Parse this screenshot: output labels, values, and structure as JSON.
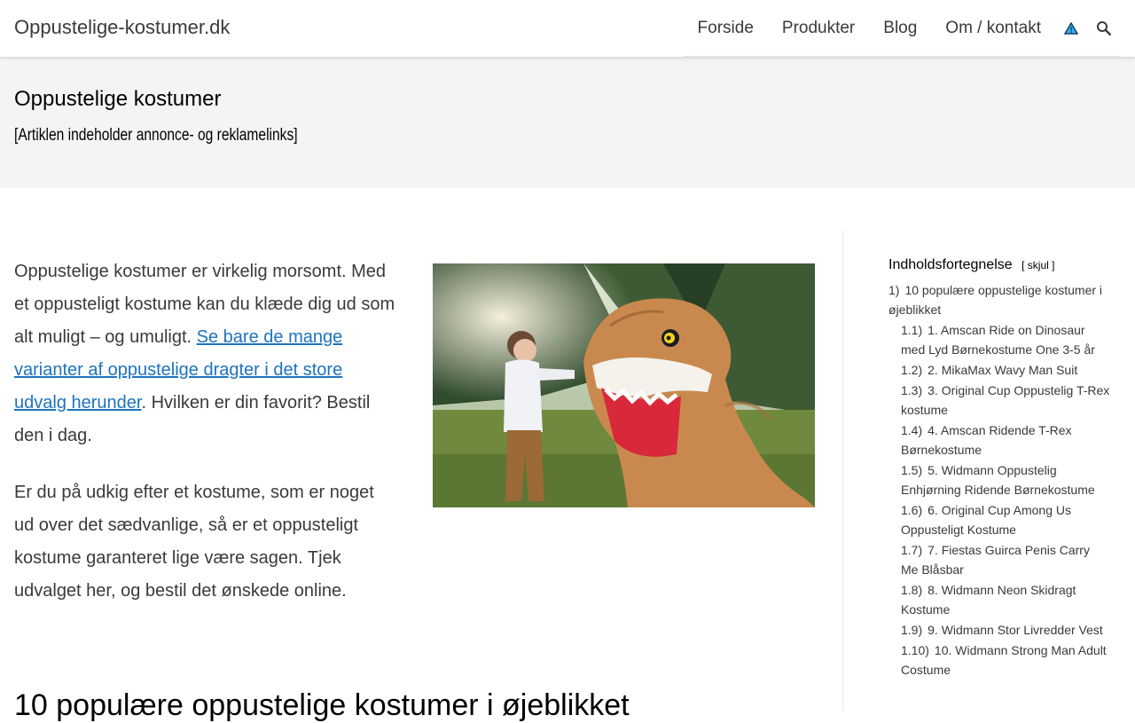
{
  "header": {
    "site_title": "Oppustelige-kostumer.dk",
    "nav": [
      "Forside",
      "Produkter",
      "Blog",
      "Om / kontakt"
    ],
    "icons": [
      "warning-triangle-icon",
      "search-icon"
    ]
  },
  "hero": {
    "title": "Oppustelige kostumer",
    "notice": "[Artiklen indeholder annonce- og reklamelinks]"
  },
  "content": {
    "p1_start": "Oppustelige kostumer er virkelig morsomt. Med et oppusteligt kostume kan du klæde dig ud som alt muligt – og umuligt. ",
    "p1_link": "Se bare de mange varianter af oppustelige dragter i det store udvalg herunder",
    "p1_end": ". Hvilken er din favorit? Bestil den i dag.",
    "p2": "Er du på udkig efter et kostume, som er noget ud over det sædvanlige, så er et oppusteligt kostume garanteret lige være sagen. Tjek udvalget her, og bestil det ønskede online.",
    "section_heading": "10 populære oppustelige kostumer i øjeblikket"
  },
  "toc": {
    "title": "Indholdsfortegnelse",
    "toggle": "[ skjul ]",
    "main": {
      "num": "1)",
      "label": "10 populære oppustelige kostumer i øjeblikket"
    },
    "items": [
      {
        "num": "1.1)",
        "label": "1. Amscan Ride on Dinosaur med Lyd Børnekostume One 3-5 år"
      },
      {
        "num": "1.2)",
        "label": "2. MikaMax Wavy Man Suit"
      },
      {
        "num": "1.3)",
        "label": "3. Original Cup Oppustelig T-Rex kostume"
      },
      {
        "num": "1.4)",
        "label": "4. Amscan Ridende T-Rex Børnekostume"
      },
      {
        "num": "1.5)",
        "label": "5. Widmann Oppustelig Enhjørning Ridende Børnekostume"
      },
      {
        "num": "1.6)",
        "label": "6. Original Cup Among Us Oppusteligt Kostume"
      },
      {
        "num": "1.7)",
        "label": "7. Fiestas Guirca Penis Carry Me Blåsbar"
      },
      {
        "num": "1.8)",
        "label": "8. Widmann Neon Skidragt Kostume"
      },
      {
        "num": "1.9)",
        "label": "9. Widmann Stor Livredder Vest"
      },
      {
        "num": "1.10)",
        "label": "10. Widmann Strong Man Adult Costume"
      }
    ]
  }
}
